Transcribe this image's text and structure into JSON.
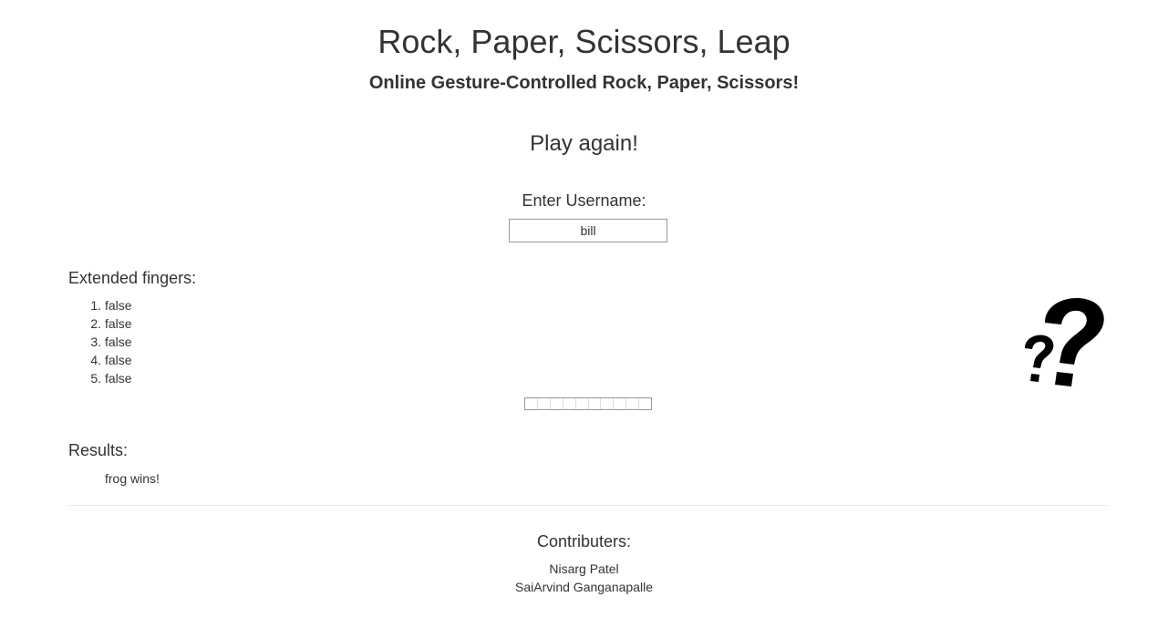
{
  "header": {
    "title": "Rock, Paper, Scissors, Leap",
    "subtitle": "Online Gesture-Controlled Rock, Paper, Scissors!"
  },
  "game": {
    "play_again": "Play again!",
    "username_label": "Enter Username:",
    "username_value": "bill"
  },
  "fingers": {
    "heading": "Extended fingers:",
    "items": [
      {
        "num": "1.",
        "value": "false"
      },
      {
        "num": "2.",
        "value": "false"
      },
      {
        "num": "3.",
        "value": "false"
      },
      {
        "num": "4.",
        "value": "false"
      },
      {
        "num": "5.",
        "value": "false"
      }
    ]
  },
  "progress": {
    "segments": 10,
    "fill": 0
  },
  "opponent": {
    "icon": "question-marks-icon"
  },
  "results": {
    "heading": "Results:",
    "text": "frog wins!"
  },
  "footer": {
    "heading": "Contributers:",
    "names": [
      "Nisarg Patel",
      "SaiArvind Ganganapalle"
    ]
  }
}
